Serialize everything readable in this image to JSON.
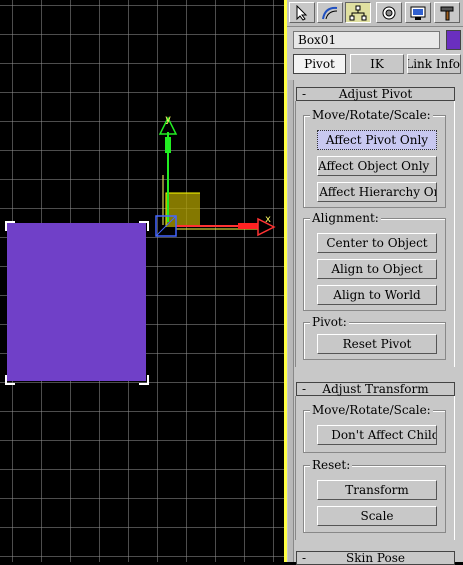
{
  "object_name": "Box01",
  "object_color": "#6a2fc0",
  "box_color": "#7040c8",
  "tabs": [
    "Pivot",
    "IK",
    "Link Info"
  ],
  "toolbar_icons": [
    "select-cursor-icon",
    "curve-icon",
    "hierarchy-icon",
    "motion-icon",
    "display-icon",
    "utilities-hammer-icon"
  ],
  "adjust_pivot": {
    "title": "Adjust Pivot",
    "collapse": "-",
    "move_group": "Move/Rotate/Scale:",
    "affect_pivot_only": "Affect Pivot Only",
    "affect_object_only": "Affect Object Only",
    "affect_hierarchy_only": "Affect Hierarchy Only",
    "alignment_group": "Alignment:",
    "center_to_object": "Center to Object",
    "align_to_object": "Align to Object",
    "align_to_world": "Align to World",
    "pivot_group": "Pivot:",
    "reset_pivot": "Reset Pivot"
  },
  "adjust_transform": {
    "title": "Adjust Transform",
    "collapse": "-",
    "move_group": "Move/Rotate/Scale:",
    "dont_affect_children": "Don't Affect Children",
    "reset_group": "Reset:",
    "transform": "Transform",
    "scale": "Scale"
  },
  "skin_pose": {
    "title": "Skin Pose",
    "collapse": "-"
  },
  "gizmo": {
    "x_label": "x",
    "y_label": "y"
  }
}
